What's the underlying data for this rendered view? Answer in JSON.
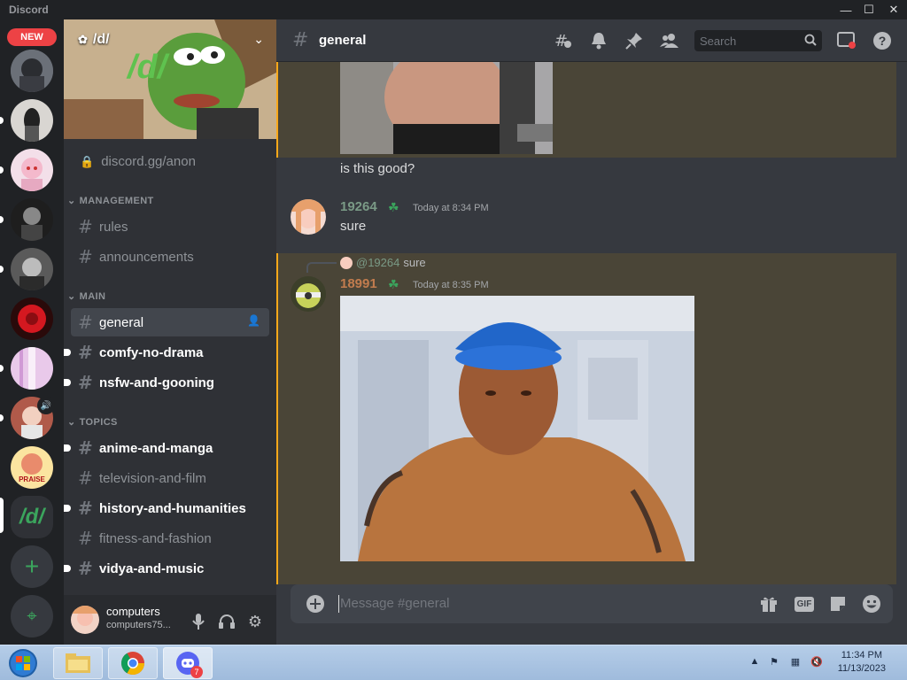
{
  "window": {
    "title": "Discord"
  },
  "guilds": {
    "new_badge": "NEW",
    "speaker_glyph": "🔊",
    "d_server_label": "/d/",
    "add_label": "+",
    "discover_label": "⌖"
  },
  "server": {
    "name": "/d/",
    "banner_text": "/d/",
    "invite": "discord.gg/anon",
    "categories": [
      {
        "label": "MANAGEMENT",
        "channels": [
          "rules",
          "announcements"
        ]
      },
      {
        "label": "MAIN",
        "channels": [
          "general",
          "comfy-no-drama",
          "nsfw-and-gooning"
        ]
      },
      {
        "label": "TOPICS",
        "channels": [
          "anime-and-manga",
          "television-and-film",
          "history-and-humanities",
          "fitness-and-fashion",
          "vidya-and-music"
        ]
      }
    ]
  },
  "user": {
    "name": "computers",
    "tag": "computers75..."
  },
  "channel": {
    "name": "general",
    "hash": "#"
  },
  "header": {
    "search_placeholder": "Search"
  },
  "messages": [
    {
      "text": "is this good?"
    },
    {
      "author": "19264",
      "timestamp": "Today at 8:34 PM",
      "text": "sure",
      "author_color": "#7a9a86"
    },
    {
      "reply_to": "@19264",
      "reply_text": "sure",
      "author": "18991",
      "timestamp": "Today at 8:35 PM",
      "author_color": "#c27c4e"
    }
  ],
  "composer": {
    "placeholder": "Message #general",
    "gif_label": "GIF"
  },
  "taskbar": {
    "time": "11:34 PM",
    "date": "11/13/2023",
    "discord_badge": "7"
  },
  "colors": {
    "accent": "#5865f2",
    "online_green": "#3ba55d",
    "highlight": "#faa81a",
    "mention_bg": "#4a4537"
  }
}
